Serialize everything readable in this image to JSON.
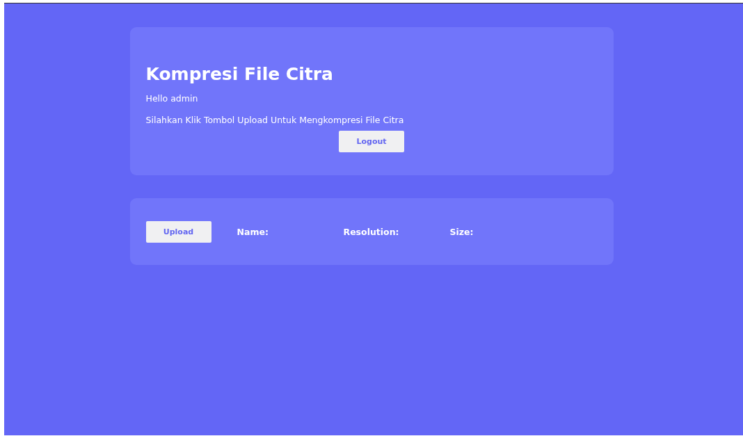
{
  "header_card": {
    "title": "Kompresi File Citra",
    "greeting": "Hello admin",
    "instruction": "Silahkan Klik Tombol Upload Untuk Mengkompresi File Citra",
    "logout_button": "Logout"
  },
  "upload_card": {
    "upload_button": "Upload",
    "fields": [
      {
        "label": "Name:"
      },
      {
        "label": "Resolution:"
      },
      {
        "label": "Size:"
      }
    ]
  }
}
